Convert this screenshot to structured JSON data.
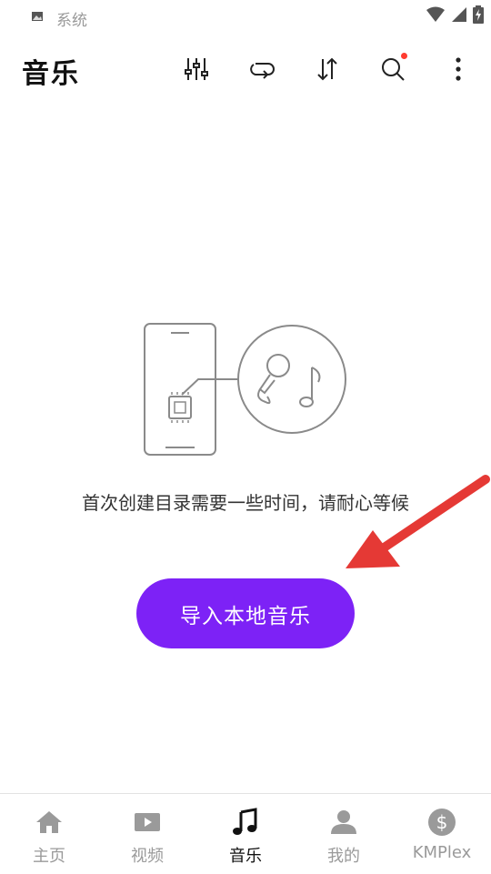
{
  "statusbar": {
    "app_label": "系统"
  },
  "appbar": {
    "title": "音乐"
  },
  "toolbar": {
    "icons": [
      "equalizer-icon",
      "repeat-icon",
      "sort-icon",
      "search-icon",
      "more-icon"
    ],
    "search_has_notification": true
  },
  "empty_state": {
    "message": "首次创建目录需要一些时间，请耐心等候",
    "import_button_label": "导入本地音乐"
  },
  "bottom_nav": {
    "items": [
      {
        "label": "主页",
        "icon": "home-icon",
        "active": false
      },
      {
        "label": "视频",
        "icon": "video-icon",
        "active": false
      },
      {
        "label": "音乐",
        "icon": "music-icon",
        "active": true
      },
      {
        "label": "我的",
        "icon": "profile-icon",
        "active": false
      },
      {
        "label": "KMPlex",
        "icon": "dollar-icon",
        "active": false
      }
    ]
  },
  "colors": {
    "accent": "#7d22f6",
    "annotation_arrow": "#e53935",
    "notification_dot": "#ff3b30"
  }
}
